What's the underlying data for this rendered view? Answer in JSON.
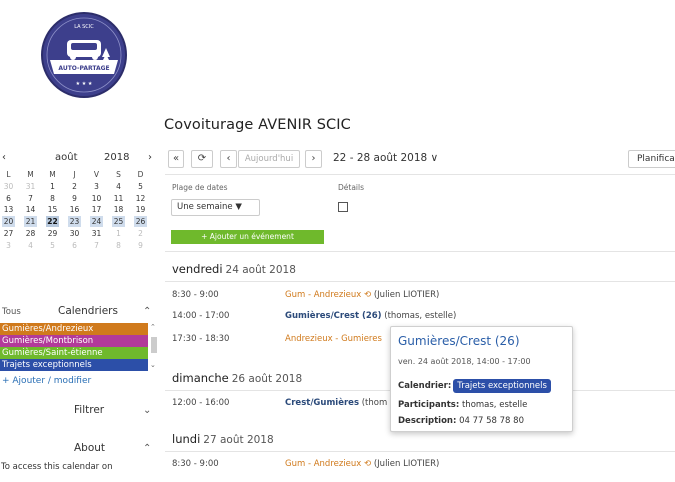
{
  "site": {
    "title": "Covoiturage AVENIR SCIC",
    "logo_top": "LA SCIC",
    "logo_text": "AUTO-PARTAGE",
    "logo_stars": "★ ★ ★"
  },
  "colors": {
    "logo_blue": "#3d3f8c",
    "accent_green": "#6fb92c",
    "event_orange": "#d07a1c",
    "event_navy": "#2b4a7a"
  },
  "mini_calendar": {
    "prev": "‹",
    "month": "août",
    "year": "2018",
    "next": "›",
    "weekdays": [
      "L",
      "M",
      "M",
      "J",
      "V",
      "S",
      "D"
    ],
    "weeks": [
      [
        "30",
        "31",
        "1",
        "2",
        "3",
        "4",
        "5"
      ],
      [
        "6",
        "7",
        "8",
        "9",
        "10",
        "11",
        "12"
      ],
      [
        "13",
        "14",
        "15",
        "16",
        "17",
        "18",
        "19"
      ],
      [
        "20",
        "21",
        "22",
        "23",
        "24",
        "25",
        "26"
      ],
      [
        "27",
        "28",
        "29",
        "30",
        "31",
        "1",
        "2"
      ],
      [
        "3",
        "4",
        "5",
        "6",
        "7",
        "8",
        "9"
      ]
    ]
  },
  "calendars": {
    "all_label": "Tous",
    "title": "Calendriers",
    "items": [
      {
        "label": "Gumières/Andrezieux",
        "color": "#d07a1c"
      },
      {
        "label": "Gumières/Montbrison",
        "color": "#b23a9a"
      },
      {
        "label": "Gumières/Saint-étienne",
        "color": "#6fb92c"
      },
      {
        "label": "Trajets exceptionnels",
        "color": "#2c4fa8"
      }
    ],
    "add_label": "+ Ajouter / modifier"
  },
  "sidebar": {
    "filter_label": "Filtrer",
    "about_label": "About",
    "about_text": "To access this calendar on"
  },
  "toolbar": {
    "first": "«",
    "refresh": "⟳",
    "prev": "‹",
    "today": "Aujourd'hui",
    "next": "›",
    "range": "22 - 28 août 2018 ∨",
    "planning": "Planifica"
  },
  "options": {
    "range_label": "Plage de dates",
    "range_value": "Une semaine ▼",
    "details_label": "Détails",
    "add_event": "+ Ajouter un événement"
  },
  "agenda": [
    {
      "day": "vendredi",
      "date": "24 août 2018",
      "events": [
        {
          "time": "8:30 - 9:00",
          "title": "Gum - Andrezieux ⟲",
          "who": " (Julien LIOTIER)",
          "color": "orange"
        },
        {
          "time": "14:00 - 17:00",
          "title": "Gumières/Crest (26)",
          "who": " (thomas, estelle)",
          "color": "navy"
        },
        {
          "time": "17:30 - 18:30",
          "title": "Andrezieux - Gumieres",
          "who": "",
          "color": "orange"
        }
      ]
    },
    {
      "day": "dimanche",
      "date": "26 août 2018",
      "events": [
        {
          "time": "12:00 - 16:00",
          "title": "Crest/Gumières",
          "who": " (thom",
          "color": "navy"
        }
      ]
    },
    {
      "day": "lundi",
      "date": "27 août 2018",
      "events": [
        {
          "time": "8:30 - 9:00",
          "title": "Gum - Andrezieux ⟲",
          "who": " (Julien LIOTIER)",
          "color": "orange"
        }
      ]
    }
  ],
  "popup": {
    "title": "Gumières/Crest (26)",
    "datetime": "ven. 24 août 2018, 14:00 - 17:00",
    "calendar_label": "Calendrier:",
    "calendar_value": "Trajets exceptionnels",
    "participants_label": "Participants:",
    "participants_value": " thomas, estelle",
    "description_label": "Description:",
    "description_value": " 04 77 58 78 80"
  }
}
